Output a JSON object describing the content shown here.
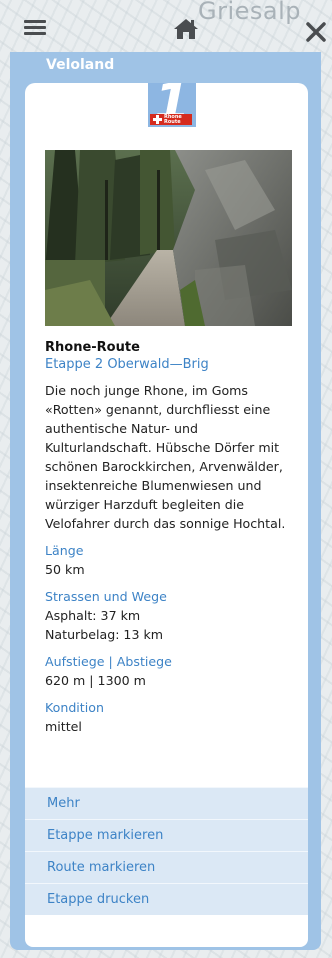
{
  "map": {
    "place_label": "Griesalp"
  },
  "panel": {
    "header": "Veloland",
    "badge": {
      "number": "1",
      "text": "Rhone Route"
    },
    "route_title": "Rhone-Route",
    "stage_title": "Etappe 2 Oberwald—Brig",
    "description": "Die noch junge Rhone, im Goms «Rotten» genannt, durchfliesst eine authentische Natur- und Kulturlandschaft. Hübsche Dörfer mit schönen Barockkirchen, Arvenwälder, insektenreiche Blumenwiesen und würziger Harzduft begleiten die Velofahrer durch das sonnige Hochtal.",
    "facts": [
      {
        "label": "Länge",
        "values": [
          "50 km"
        ]
      },
      {
        "label": "Strassen und Wege",
        "values": [
          "Asphalt: 37 km",
          "Naturbelag: 13 km"
        ]
      },
      {
        "label": "Aufstiege | Abstiege",
        "values": [
          "620 m | 1300 m"
        ]
      },
      {
        "label": "Kondition",
        "values": [
          "mittel"
        ]
      }
    ],
    "actions": [
      "Mehr",
      "Etappe markieren",
      "Route markieren",
      "Etappe drucken"
    ]
  },
  "icons": {
    "menu": "hamburger-icon",
    "home": "home-icon",
    "close": "close-icon"
  }
}
